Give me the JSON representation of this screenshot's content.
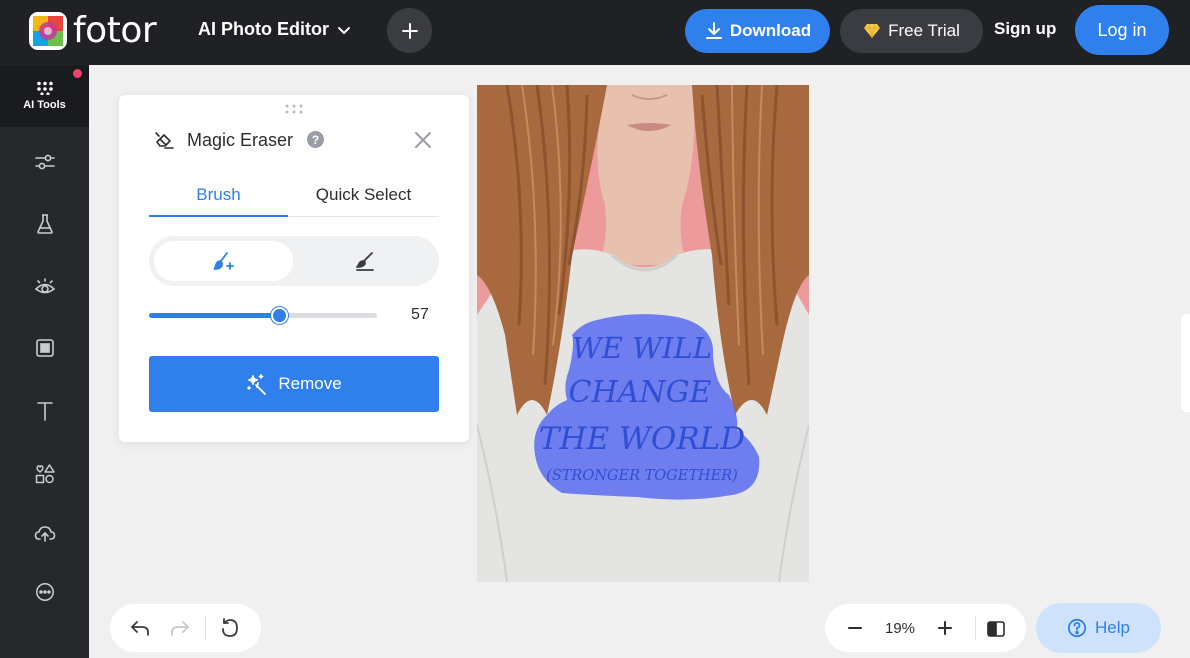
{
  "header": {
    "logo_text": "fotor",
    "editor_menu_label": "AI Photo Editor",
    "download_label": "Download",
    "free_trial_label": "Free Trial",
    "sign_up_label": "Sign up",
    "log_in_label": "Log in"
  },
  "sidebar": {
    "items": [
      {
        "name": "ai-tools",
        "label": "AI Tools",
        "icon": "grid-dots-icon",
        "active": true
      },
      {
        "name": "adjust",
        "icon": "sliders-icon"
      },
      {
        "name": "effects",
        "icon": "flask-icon"
      },
      {
        "name": "beauty",
        "icon": "eye-icon"
      },
      {
        "name": "frames",
        "icon": "frame-icon"
      },
      {
        "name": "text",
        "icon": "text-icon"
      },
      {
        "name": "elements",
        "icon": "shapes-icon"
      },
      {
        "name": "uploads",
        "icon": "cloud-upload-icon"
      },
      {
        "name": "more",
        "icon": "more-icon"
      }
    ]
  },
  "panel": {
    "title": "Magic Eraser",
    "help_glyph": "?",
    "tabs": [
      {
        "label": "Brush",
        "active": true
      },
      {
        "label": "Quick Select",
        "active": false
      }
    ],
    "modes": [
      {
        "name": "brush-add",
        "icon": "brush-plus-icon",
        "active": true
      },
      {
        "name": "brush-erase",
        "icon": "brush-minus-icon",
        "active": false
      }
    ],
    "brush_size": 57,
    "brush_size_max": 100,
    "remove_label": "Remove"
  },
  "canvas": {
    "shirt_text_lines": [
      "WE WILL",
      "CHANGE",
      "THE WORLD",
      "(STRONGER TOGETHER)"
    ]
  },
  "footer": {
    "zoom_value": "19%",
    "help_label": "Help"
  },
  "colors": {
    "accent": "#2f80ed",
    "topbar": "#1f2125",
    "sidebar": "#26282c",
    "mask": "#5b6cf0"
  }
}
